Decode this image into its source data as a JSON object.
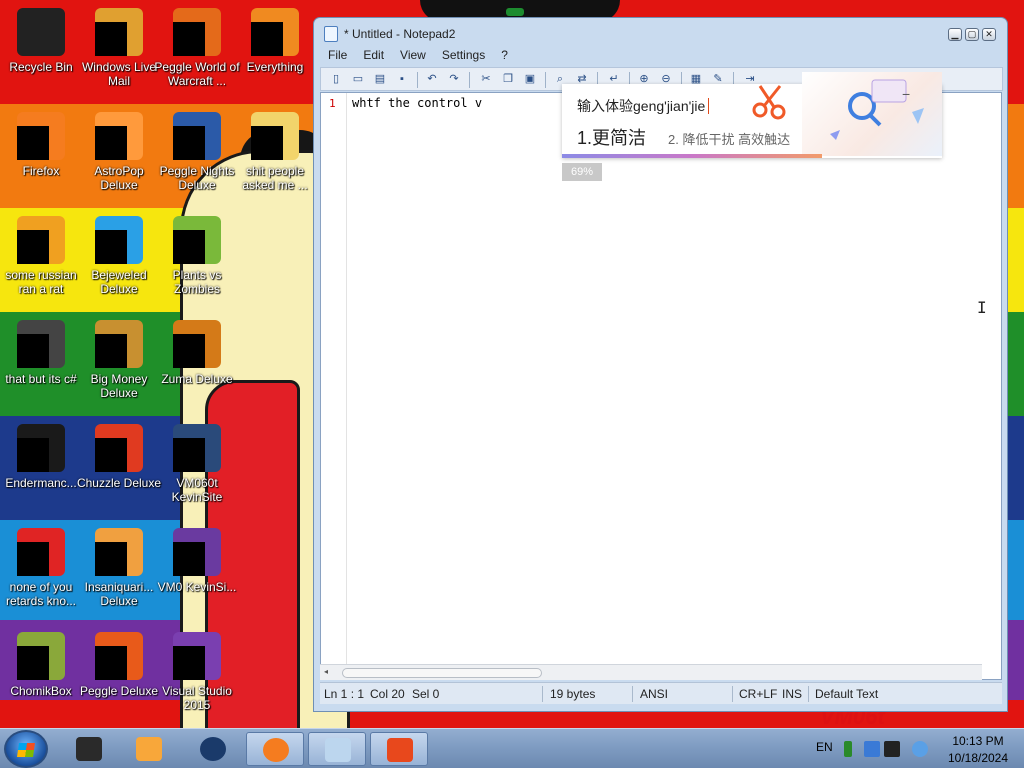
{
  "desktop": {
    "icons": [
      {
        "label": "Recycle Bin",
        "color": "#222"
      },
      {
        "label": "Windows Live Mail",
        "color": "#e0a030"
      },
      {
        "label": "Peggle World of Warcraft ...",
        "color": "#e46a1a"
      },
      {
        "label": "Everything",
        "color": "#f08a20"
      },
      {
        "label": "Firefox",
        "color": "#f57c1f"
      },
      {
        "label": "AstroPop Deluxe",
        "color": "#ff9a3c"
      },
      {
        "label": "Peggle Nights Deluxe",
        "color": "#2b5aa8"
      },
      {
        "label": "shit people asked me ...",
        "color": "#f2d46b"
      },
      {
        "label": "some russian ran a rat",
        "color": "#f0a020"
      },
      {
        "label": "Bejeweled Deluxe",
        "color": "#2aa0e6"
      },
      {
        "label": "Plants vs Zombies",
        "color": "#7ab93a"
      },
      {
        "label": "that but its c#",
        "color": "#444"
      },
      {
        "label": "Big Money Deluxe",
        "color": "#c89030"
      },
      {
        "label": "Zuma Deluxe",
        "color": "#d47a18"
      },
      {
        "label": "Endermanc...",
        "color": "#1a1a1a"
      },
      {
        "label": "Chuzzle Deluxe",
        "color": "#e03a20"
      },
      {
        "label": "VM060t KevinSite",
        "color": "#2a4a7a"
      },
      {
        "label": "none of you retards kno...",
        "color": "#e02424"
      },
      {
        "label": "Insaniquari... Deluxe",
        "color": "#f0a040"
      },
      {
        "label": "VM0 KevinSi...",
        "color": "#6a3aa0"
      },
      {
        "label": "ChomikBox",
        "color": "#8aa83a"
      },
      {
        "label": "Peggle Deluxe",
        "color": "#e85a1a"
      },
      {
        "label": "Visual Studio 2015",
        "color": "#7a3fb0"
      }
    ],
    "wallpaper_text": "VM06t"
  },
  "notepad": {
    "title": "* Untitled - Notepad2",
    "window_buttons": [
      "minimize",
      "maximize",
      "close"
    ],
    "menu": [
      "File",
      "Edit",
      "View",
      "Settings",
      "?"
    ],
    "toolbar_icons": [
      "new-icon",
      "open-icon",
      "browse-icon",
      "save-icon",
      "undo-icon",
      "redo-icon",
      "cut-icon",
      "copy-icon",
      "paste-icon",
      "find-icon",
      "replace-icon",
      "wordwrap-icon",
      "zoom-in-icon",
      "zoom-out-icon",
      "scheme-icon",
      "customize-icon",
      "exit-icon"
    ],
    "line_number": "1",
    "content": "whtf the control v",
    "status": {
      "position": "Ln 1 : 1",
      "column": "Col 20",
      "selection": "Sel 0",
      "size": "19 bytes",
      "encoding": "ANSI",
      "line_ending": "CR+LF",
      "mode": "INS",
      "scheme": "Default Text"
    }
  },
  "ime": {
    "composition": "输入体验geng'jian'jie",
    "candidate1": "1.更简洁",
    "candidate2": "2. 降低干扰 高效触达",
    "progress": "69%",
    "minimize": "−"
  },
  "taskbar": {
    "apps": [
      {
        "name": "taskbar-app-1",
        "color": "#2a2a2a"
      },
      {
        "name": "taskbar-app-2",
        "color": "#f08a20"
      },
      {
        "name": "taskbar-app-3",
        "color": "#1a3a6a"
      },
      {
        "name": "taskbar-firefox",
        "color": "#f57c1f"
      },
      {
        "name": "taskbar-notepad2",
        "color": "#bcd6ee"
      },
      {
        "name": "taskbar-sogou",
        "color": "#e8481c"
      }
    ],
    "language": "EN",
    "time": "10:13 PM",
    "date": "10/18/2024"
  }
}
